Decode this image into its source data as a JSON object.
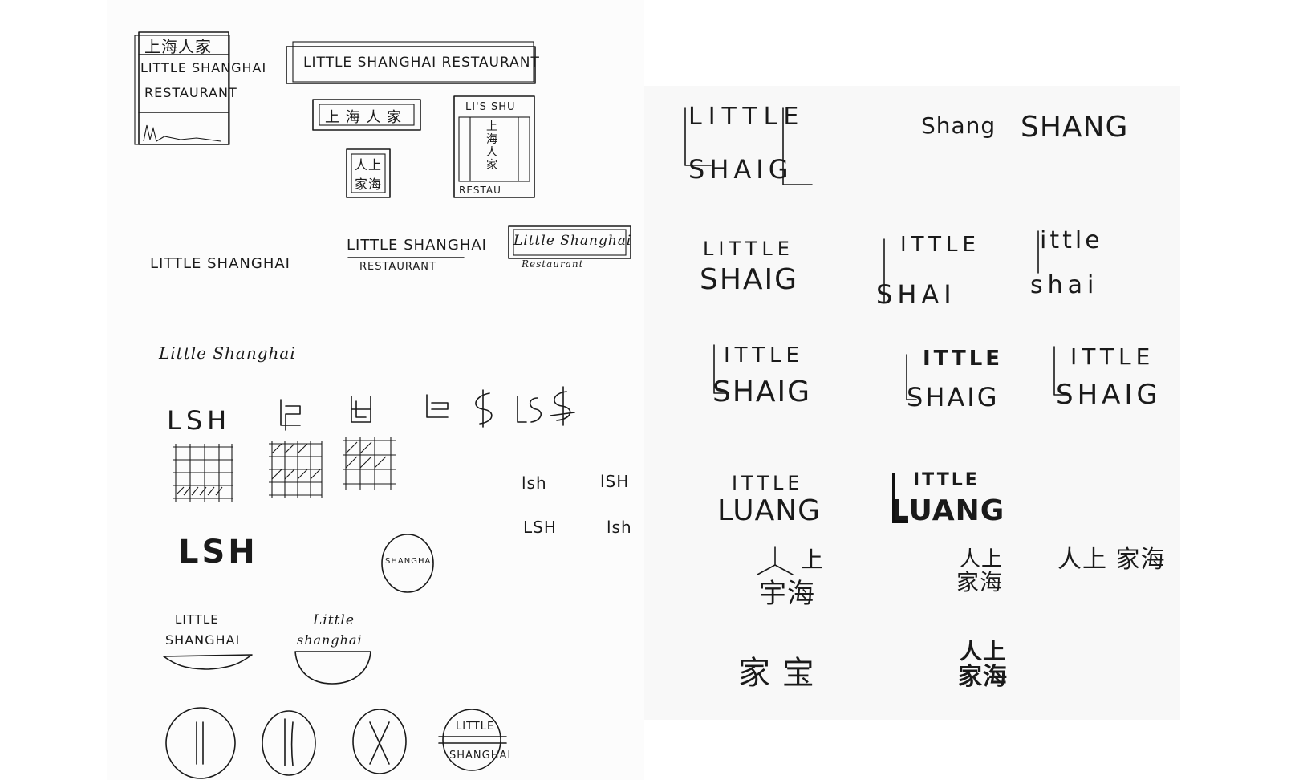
{
  "left_sheet": {
    "sign_vertical": {
      "cn": "上海人家",
      "line1": "LITTLE SHANGHAI",
      "line2": "RESTAURANT"
    },
    "banner": {
      "text": "LITTLE SHANGHAI RESTAURANT"
    },
    "cn_banner": {
      "text": "上 海 人 家"
    },
    "cn_square": {
      "top": "人上",
      "bottom": "家海"
    },
    "tall_sign": {
      "top": "LI'S SHU",
      "cn": "上海人家",
      "bottom": "RESTAU"
    },
    "wordmarks": {
      "plain": "LITTLE SHANGHAI",
      "underlined": "LITTLE SHANGHAI",
      "underlined_sub": "RESTAURANT",
      "boxed": "Little Shanghai",
      "boxed_sub": "Restaurant",
      "script": "Little Shanghai"
    },
    "monograms": {
      "lsh1": "LSH",
      "lsh2": "LSH"
    },
    "small_marks": {
      "a": "lsh",
      "b": "lSH",
      "c": "LSH",
      "d": "lsh"
    },
    "circle_badge": {
      "text": "SHANGHAI"
    },
    "plates": {
      "plate_top": "LITTLE",
      "plate_bottom": "SHANGHAI",
      "bowl_top": "Little",
      "bowl_bottom": "shanghai"
    },
    "chopstick_badge": {
      "top": "LITTLE",
      "bottom": "SHANGHAI"
    }
  },
  "right_sheet": {
    "row1": {
      "big_a": "LITTLE",
      "big_b": "SHAIG",
      "shang": "Shang",
      "shang2": "SHANG"
    },
    "row2": {
      "a_top": "LITTLE",
      "a_bottom": "SHAIG",
      "b_top": "ITTLE",
      "b_bottom": "SHAI",
      "c_top": "ittle",
      "c_bottom": "shai"
    },
    "row3": {
      "a_top": "ITTLE",
      "a_bottom": "SHAIG",
      "b_top": "ITTLE",
      "b_bottom": "SHAIG",
      "c_top": "ITTLE",
      "c_bottom": "SHAIG"
    },
    "row4": {
      "a": "LUANG",
      "b": "LUANG",
      "a_top": "ITTLE",
      "b_top": "ITTLE"
    },
    "cn_row1": {
      "a_top": "上",
      "a_bottom": "宇海",
      "b_top": "人上",
      "b_bottom": "家海",
      "c": "人上 家海"
    },
    "cn_row2": {
      "a": "家 宝",
      "b_top": "人上",
      "b_bottom": "家海"
    }
  }
}
